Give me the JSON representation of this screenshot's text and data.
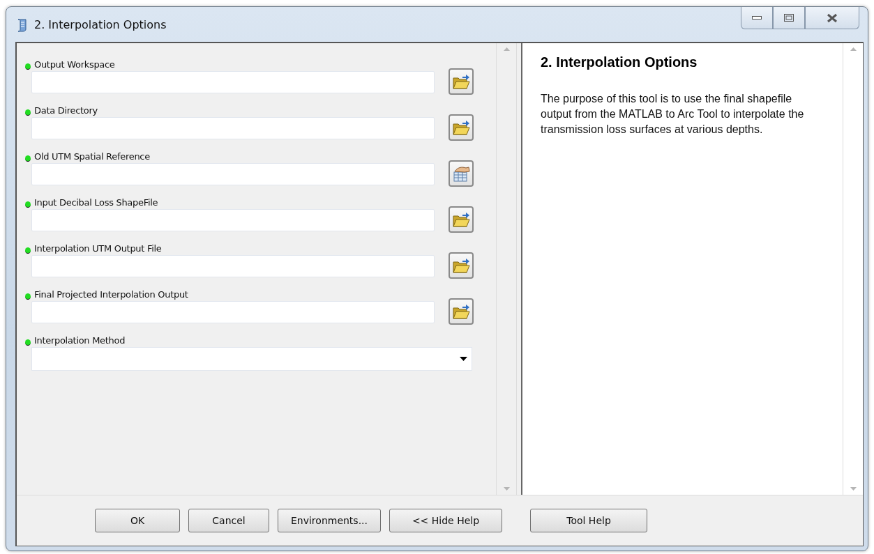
{
  "window": {
    "title": "2. Interpolation Options"
  },
  "parameters": [
    {
      "label": "Output Workspace",
      "kind": "folder",
      "required": true
    },
    {
      "label": "Data Directory",
      "kind": "folder",
      "required": true
    },
    {
      "label": "Old UTM Spatial Reference",
      "kind": "spatial-reference",
      "required": true
    },
    {
      "label": "Input Decibal Loss ShapeFile",
      "kind": "folder",
      "required": true
    },
    {
      "label": "Interpolation UTM Output File",
      "kind": "folder",
      "required": true
    },
    {
      "label": "Final Projected Interpolation Output",
      "kind": "folder",
      "required": true
    },
    {
      "label": "Interpolation Method",
      "kind": "dropdown",
      "required": true
    }
  ],
  "help": {
    "title": "2. Interpolation Options",
    "body": "The purpose of this tool is to use the final shapefile output from the MATLAB to Arc Tool to interpolate the transmission loss surfaces at various depths."
  },
  "buttons": [
    {
      "label": "OK"
    },
    {
      "label": "Cancel"
    },
    {
      "label": "Environments..."
    },
    {
      "label": "<< Hide Help"
    },
    {
      "label": "Tool Help"
    }
  ]
}
